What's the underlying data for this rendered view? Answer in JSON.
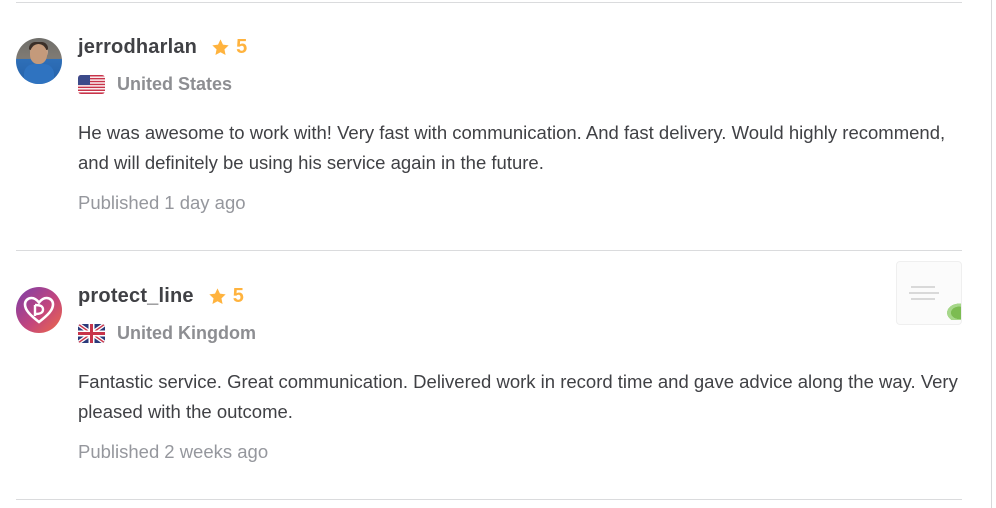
{
  "reviews": [
    {
      "username": "jerrodharlan",
      "rating": "5",
      "country": "United States",
      "flag_icon": "us-flag-icon",
      "text": "He was awesome to work with! Very fast with communication. And fast delivery. Would highly recommend, and will definitely be using his service again in the future.",
      "published_label": "Published",
      "published_time": "1 day ago"
    },
    {
      "username": "protect_line",
      "rating": "5",
      "country": "United Kingdom",
      "flag_icon": "uk-flag-icon",
      "text": "Fantastic service. Great communication. Delivered work in record time and gave advice along the way. Very pleased with the outcome.",
      "published_label": "Published",
      "published_time": "2 weeks ago"
    }
  ],
  "colors": {
    "star": "#ffb33e",
    "muted_text": "#95979d",
    "divider": "#dadbdd"
  }
}
